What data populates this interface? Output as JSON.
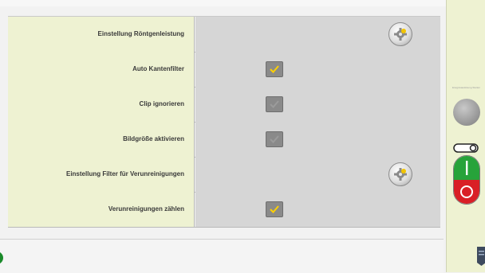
{
  "settings": {
    "rows": [
      {
        "label": "Einstellung Röntgenleistung",
        "control": "gear-button"
      },
      {
        "label": "Auto Kantenfilter",
        "control": "checkbox",
        "checked": true,
        "enabled": true
      },
      {
        "label": "Clip ignorieren",
        "control": "checkbox",
        "checked": false,
        "enabled": false
      },
      {
        "label": "Bildgröße aktivieren",
        "control": "checkbox",
        "checked": false,
        "enabled": false
      },
      {
        "label": "Einstellung Filter für Verunreinigungen",
        "control": "gear-button"
      },
      {
        "label": "Verunreinigungen zählen",
        "control": "checkbox",
        "checked": true,
        "enabled": true
      }
    ]
  },
  "sidepanel": {
    "knob_label": "Ereignisauslösung Starten",
    "power_on_color": "#27a33a",
    "power_off_color": "#d91f26"
  },
  "colors": {
    "label_background": "#eef2d2",
    "value_background": "#d6d6d6",
    "check_active": "#ffd000"
  }
}
